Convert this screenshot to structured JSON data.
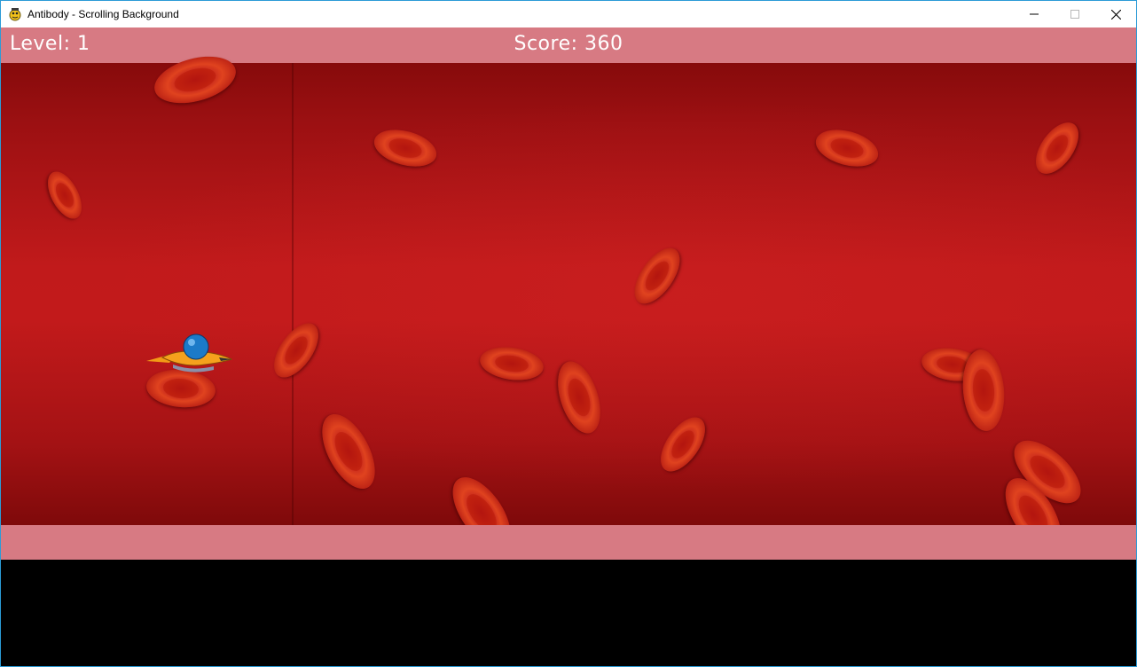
{
  "window": {
    "title": "Antibody - Scrolling Background",
    "icon": "pygame-snake-icon",
    "controls": [
      "minimize-icon",
      "maximize-icon",
      "close-icon"
    ]
  },
  "hud": {
    "level": "Level: 1",
    "score": "Score: 360"
  },
  "game": {
    "player": "antibody-ship",
    "enemies": "red-blood-cells"
  },
  "colors": {
    "hud_band": "#d77a83",
    "vessel": "#c11a1b",
    "cell": "#d63a1d",
    "hud_text": "#ffffff"
  }
}
